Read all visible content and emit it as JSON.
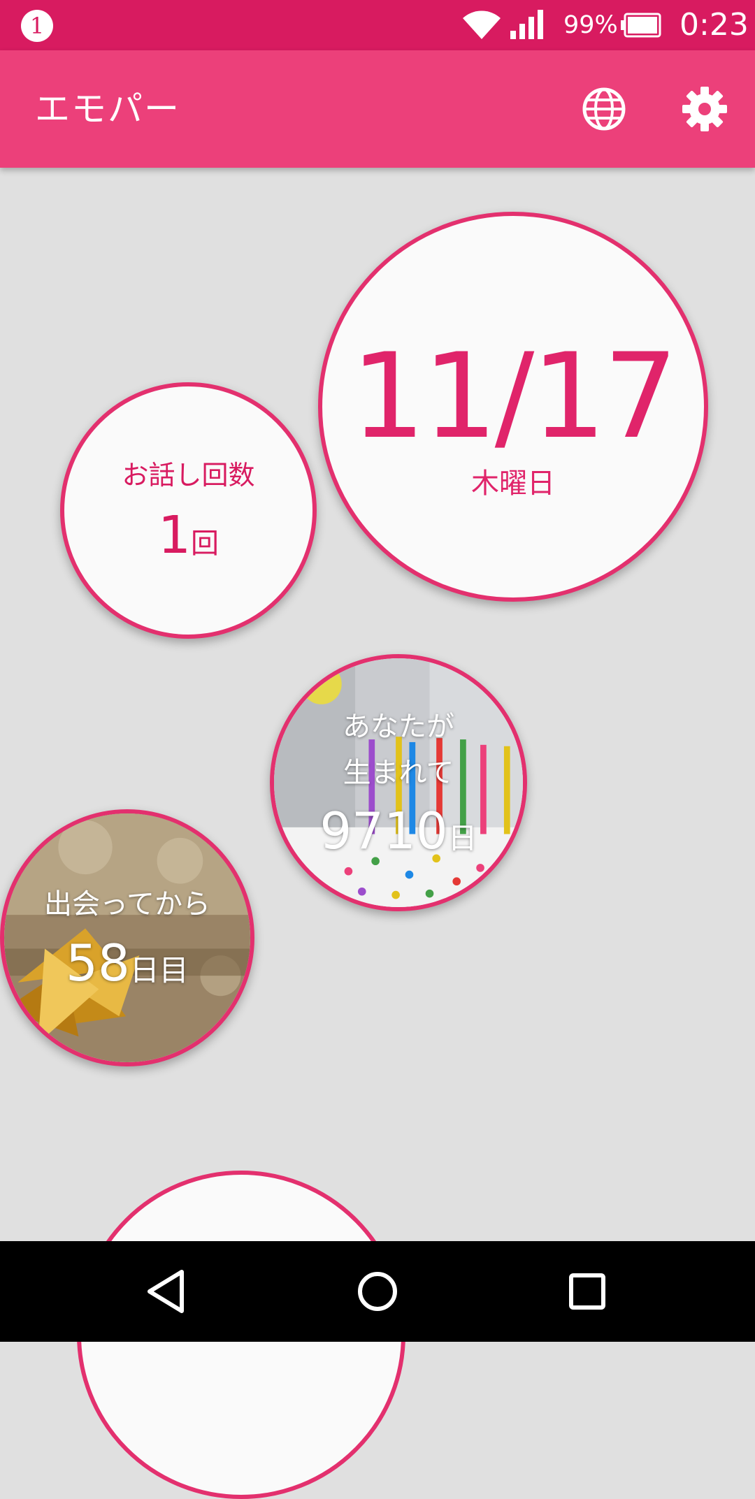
{
  "status_bar": {
    "notification_badge": "1",
    "battery_percent": "99%",
    "time": "0:23",
    "icons": [
      "wifi-icon",
      "signal-icon",
      "battery-icon"
    ]
  },
  "app_bar": {
    "title": "エモパー",
    "actions": [
      "globe-icon",
      "gear-icon"
    ],
    "color": "#ec407a"
  },
  "bubbles": {
    "date": {
      "value": "11/17",
      "weekday": "木曜日"
    },
    "talk_count": {
      "label": "お話し回数",
      "value": "1",
      "unit": "回"
    },
    "born": {
      "line1": "あなたが",
      "line2": "生まれて",
      "value": "9710",
      "unit": "日"
    },
    "met": {
      "label": "出会ってから",
      "value": "58",
      "unit": "日目"
    }
  },
  "colors": {
    "status_bar": "#d81b60",
    "accent": "#e3306e",
    "background": "#e0e0e0"
  },
  "nav_bar": {
    "buttons": [
      "back-icon",
      "home-icon",
      "recents-icon"
    ]
  }
}
